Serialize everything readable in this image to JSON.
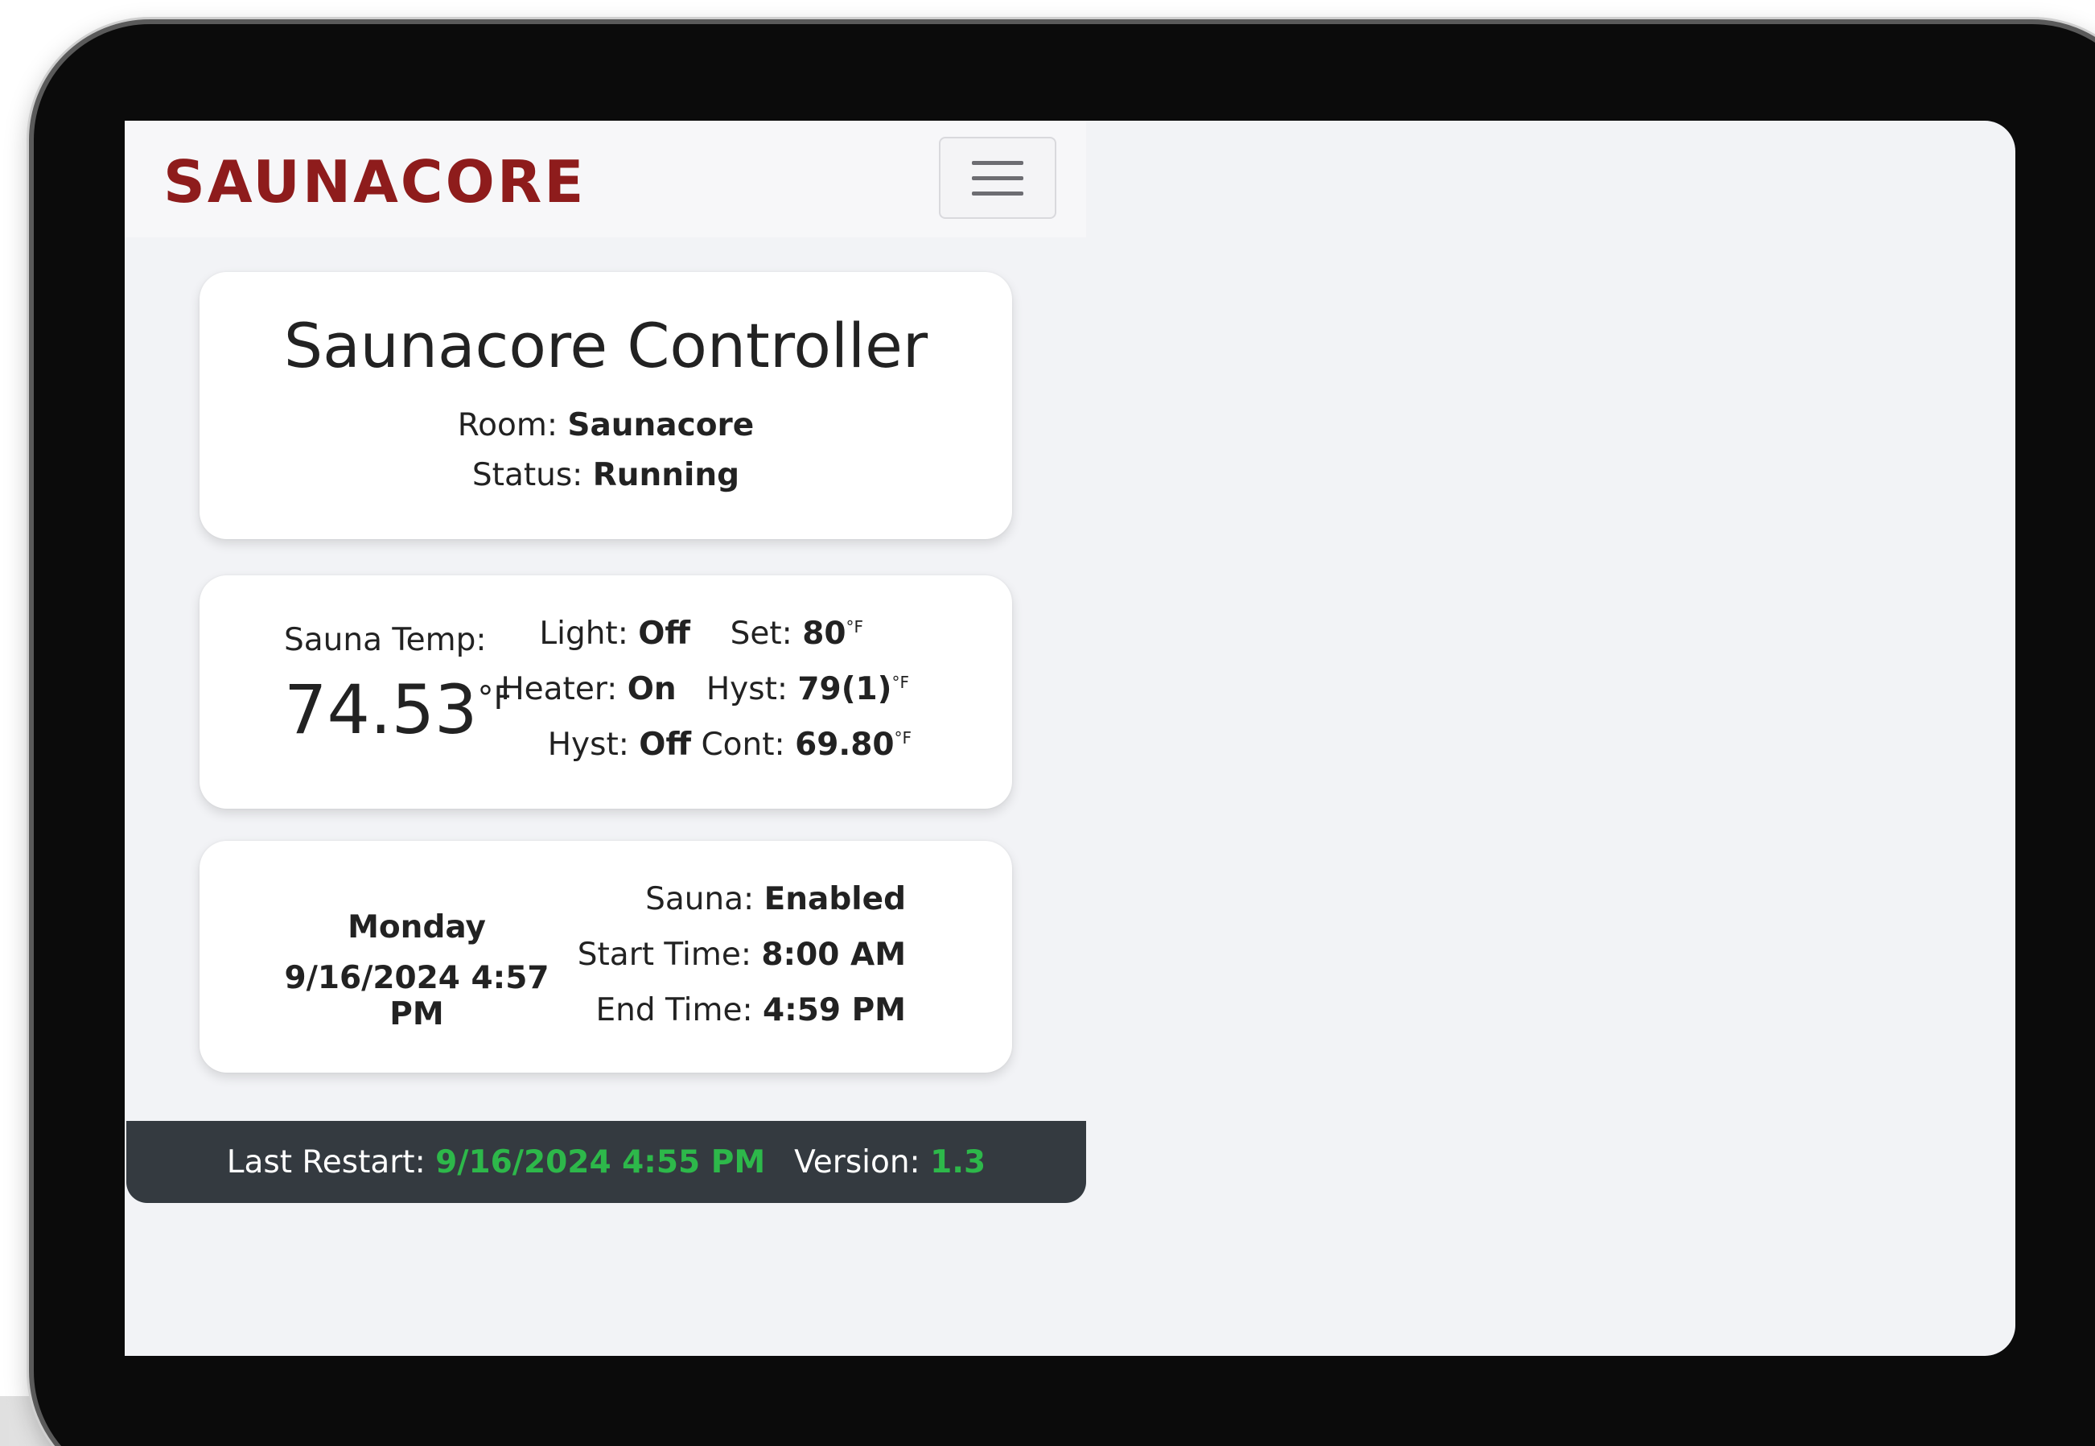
{
  "navbar": {
    "brand": "SAUNACORE",
    "menu_icon": "hamburger-menu-icon"
  },
  "header_card": {
    "title": "Saunacore Controller",
    "room_label": "Room:",
    "room_value": "Saunacore",
    "status_label": "Status:",
    "status_value": "Running"
  },
  "temp_card": {
    "label": "Sauna Temp:",
    "value": "74.53",
    "unit": "°F",
    "light_label": "Light:",
    "light_value": "Off",
    "set_label": "Set:",
    "set_value": "80",
    "heater_label": "Heater:",
    "heater_value": "On",
    "hyst_label": "Hyst:",
    "hyst_value": "79(1)",
    "hyst_state_label": "Hyst:",
    "hyst_state_value": "Off",
    "cont_label": "Cont:",
    "cont_value": "69.80",
    "small_unit": "°F"
  },
  "schedule_card": {
    "day": "Monday",
    "datetime": "9/16/2024 4:57 PM",
    "sauna_label": "Sauna:",
    "sauna_value": "Enabled",
    "start_label": "Start Time:",
    "start_value": "8:00 AM",
    "end_label": "End Time:",
    "end_value": "4:59 PM"
  },
  "footer": {
    "restart_label": "Last Restart:",
    "restart_value": "9/16/2024 4:55 PM",
    "version_label": "Version:",
    "version_value": "1.3"
  },
  "colors": {
    "brand": "#8e1c1c",
    "footer_bg": "#343a40",
    "footer_accent": "#2db84a"
  }
}
